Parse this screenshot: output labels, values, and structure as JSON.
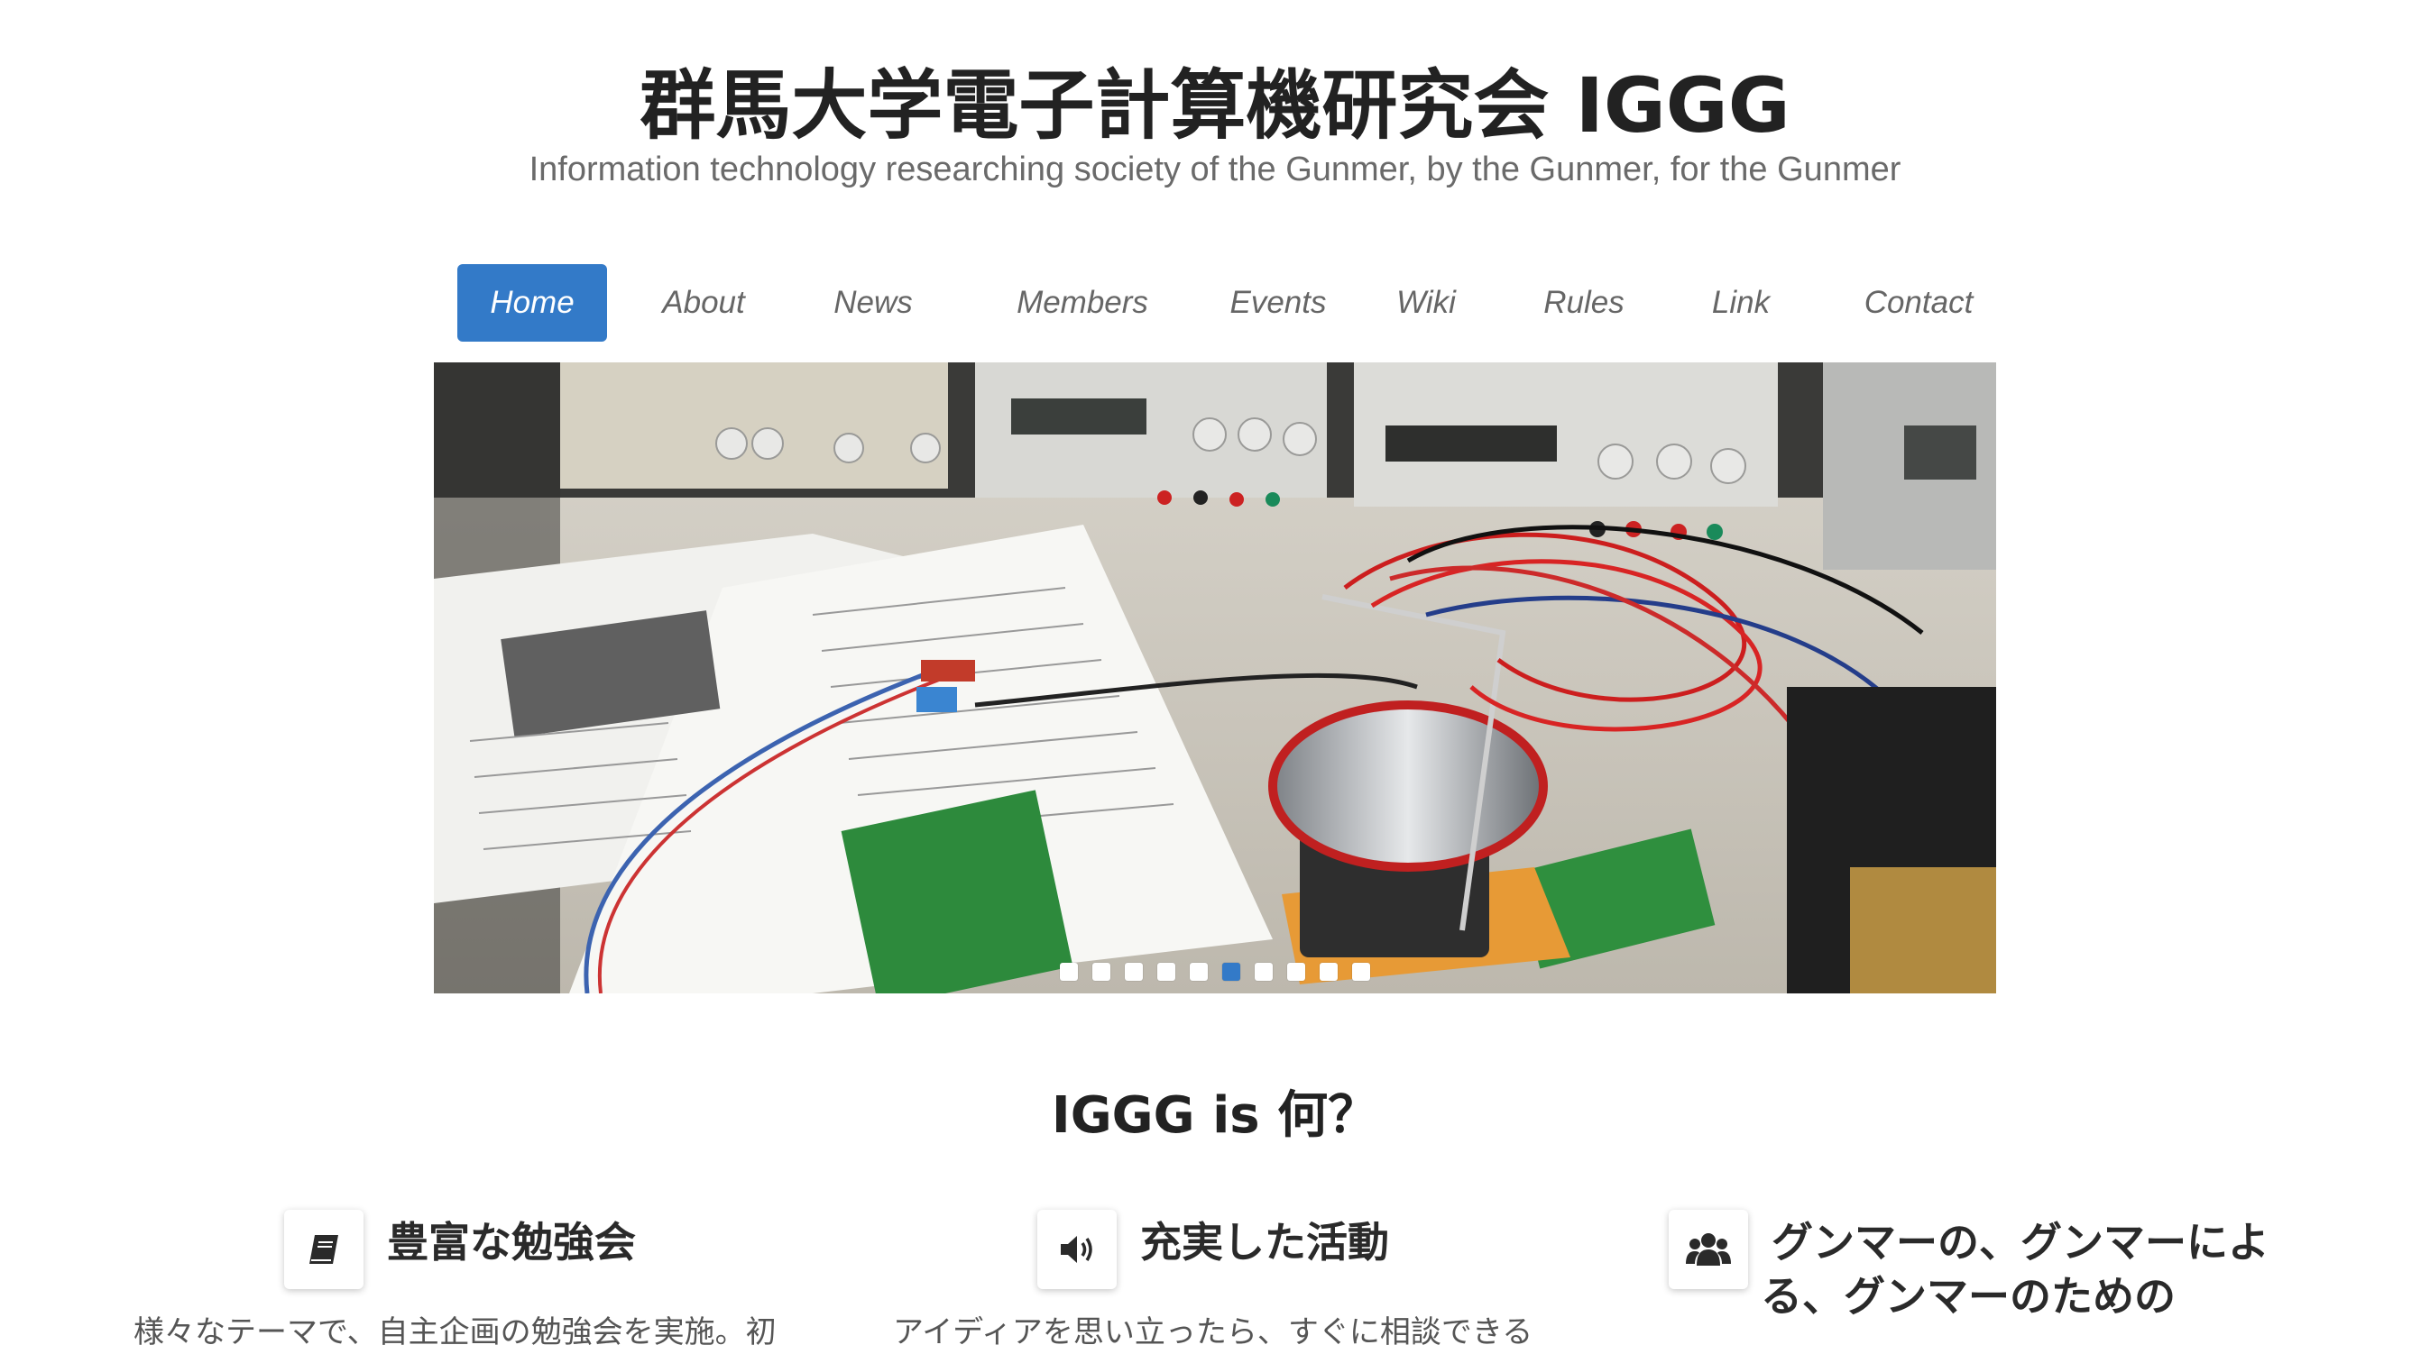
{
  "header": {
    "title": "群馬大学電子計算機研究会 IGGG",
    "subtitle": "Information technology researching society of the Gunmer, by the Gunmer, for the Gunmer"
  },
  "nav": {
    "items": [
      {
        "label": "Home",
        "active": true
      },
      {
        "label": "About"
      },
      {
        "label": "News"
      },
      {
        "label": "Members"
      },
      {
        "label": "Events"
      },
      {
        "label": "Wiki"
      },
      {
        "label": "Rules"
      },
      {
        "label": "Link"
      },
      {
        "label": "Contact"
      }
    ]
  },
  "carousel": {
    "slide_count": 10,
    "active_index": 5
  },
  "about": {
    "heading": "IGGG is 何？"
  },
  "features": [
    {
      "icon": "book-icon",
      "title": "豊富な勉強会",
      "text": "様々なテーマで、自主企画の勉強会を実施。初"
    },
    {
      "icon": "volume-icon",
      "title": "充実した活動",
      "text": "アイディアを思い立ったら、すぐに相談できる"
    },
    {
      "icon": "users-icon",
      "title": "グンマーの、グンマーによる、グンマーのための",
      "title_line1": "グンマーの、グンマーによ",
      "title_line2": "る、グンマーのための",
      "text": ""
    }
  ],
  "colors": {
    "accent": "#337ac8",
    "text": "#2a2a2a",
    "muted": "#6a6a6a"
  }
}
